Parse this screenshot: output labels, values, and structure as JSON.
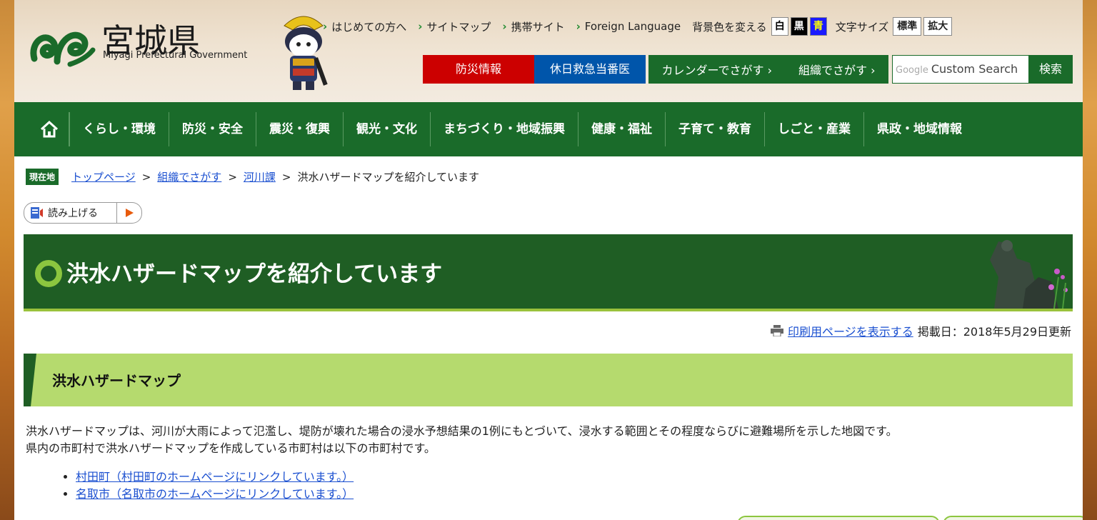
{
  "header": {
    "title": "宮城県",
    "subtitle": "Miyagi Prefectural Government",
    "top_links": [
      "はじめての方へ",
      "サイトマップ",
      "携帯サイト",
      "Foreign Language"
    ],
    "bg_color_label": "背景色を変える",
    "bg_options": [
      {
        "label": "白",
        "bg": "#ffffff",
        "fg": "#000000"
      },
      {
        "label": "黒",
        "bg": "#000000",
        "fg": "#ffffff"
      },
      {
        "label": "青",
        "bg": "#1a1aff",
        "fg": "#ffff00"
      }
    ],
    "font_size_label": "文字サイズ",
    "font_sizes": [
      "標準",
      "拡大"
    ],
    "disaster_info": "防災情報",
    "holiday_doctor": "休日救急当番医",
    "calendar_search": "カレンダーでさがす",
    "org_search": "組織でさがす",
    "search_placeholder": "Custom Search",
    "search_google": "Google",
    "search_button": "検索"
  },
  "nav": {
    "items": [
      "くらし・環境",
      "防災・安全",
      "震災・復興",
      "観光・文化",
      "まちづくり・地域振興",
      "健康・福祉",
      "子育て・教育",
      "しごと・産業",
      "県政・地域情報"
    ]
  },
  "breadcrumb": {
    "here_label": "現在地",
    "items": [
      "トップページ",
      "組織でさがす",
      "河川課"
    ],
    "current": "洪水ハザードマップを紹介しています",
    "separator": ">"
  },
  "read_aloud": "読み上げる",
  "page_title": "洪水ハザードマップを紹介しています",
  "meta": {
    "print_link": "印刷用ページを表示する",
    "date": "掲載日：2018年5月29日更新"
  },
  "section": {
    "heading": "洪水ハザードマップ",
    "paragraph1": "洪水ハザードマップは、河川が大雨によって氾濫し、堤防が壊れた場合の浸水予想結果の1例にもとづいて、浸水する範囲とその程度ならびに避難場所を示した地図です。",
    "paragraph2": "県内の市町村で洪水ハザードマップを作成している市町村は以下の市町村です。",
    "links": [
      "村田町（村田町のホームページにリンクしています。）",
      "名取市（名取市のホームページにリンクしています。）"
    ]
  },
  "colors": {
    "brand_green": "#1a6b2a",
    "accent_light_green": "#b5da6e",
    "disaster_red": "#cc0000",
    "emergency_blue": "#0055aa",
    "link_blue": "#1a4fd0"
  }
}
